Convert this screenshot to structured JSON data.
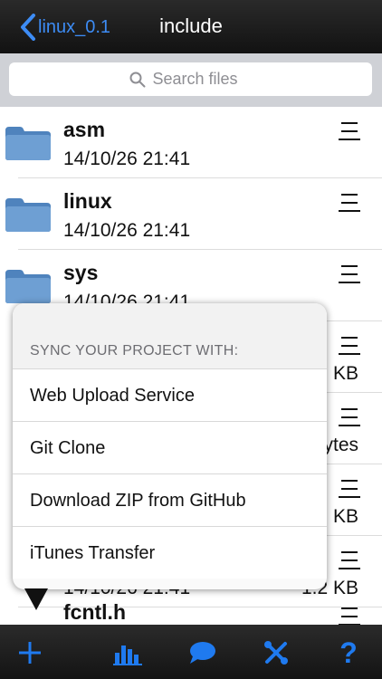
{
  "nav": {
    "back_label": "linux_0.1",
    "title": "include"
  },
  "search": {
    "placeholder": "Search files"
  },
  "files": [
    {
      "name": "asm",
      "date": "14/10/26 21:41",
      "size": ""
    },
    {
      "name": "linux",
      "date": "14/10/26 21:41",
      "size": ""
    },
    {
      "name": "sys",
      "date": "14/10/26 21:41",
      "size": ""
    },
    {
      "name": "",
      "date": "",
      "size": "KB"
    },
    {
      "name": "",
      "date": "",
      "size": "ytes"
    },
    {
      "name": "",
      "date": "",
      "size": "KB"
    },
    {
      "name": "",
      "date": "14/10/26 21:41",
      "size": "1.2 KB"
    },
    {
      "name": "fcntl.h",
      "date": "",
      "size": ""
    }
  ],
  "popover": {
    "header": "SYNC YOUR PROJECT WITH:",
    "items": [
      {
        "label": "Web Upload Service"
      },
      {
        "label": "Git Clone"
      },
      {
        "label": "Download ZIP from GitHub"
      },
      {
        "label": "iTunes Transfer"
      }
    ]
  },
  "toolbar": {
    "icons": [
      "add-icon",
      "stats-icon",
      "chat-icon",
      "tools-icon",
      "help-icon"
    ],
    "help_label": "?"
  },
  "colors": {
    "accent": "#1f7aef",
    "back": "#3d8cf5",
    "folder": "#5b8ec6"
  }
}
